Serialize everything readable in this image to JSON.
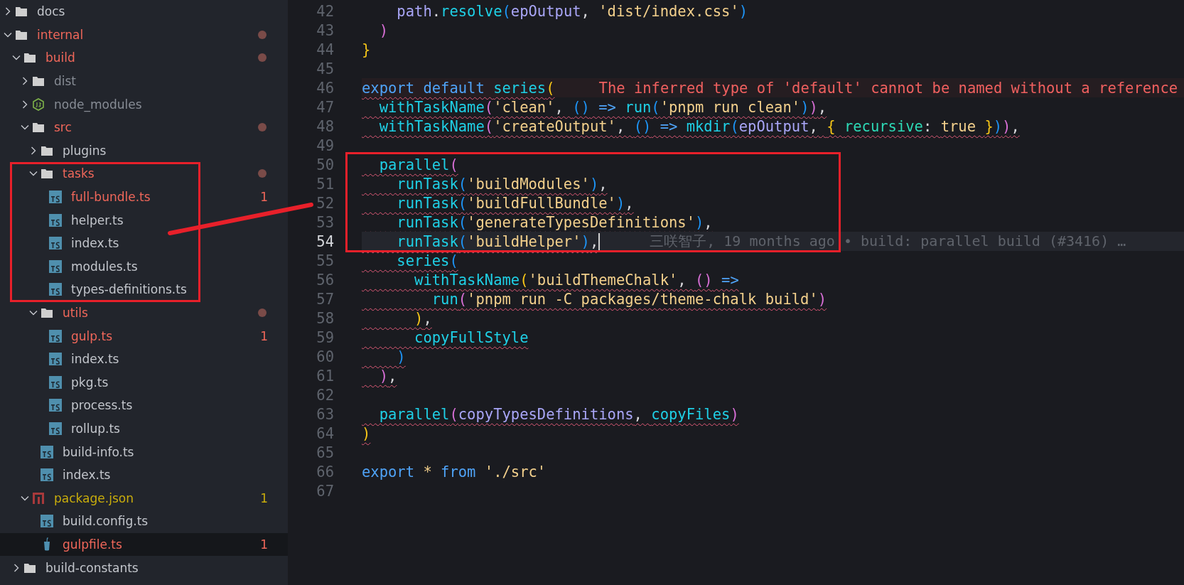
{
  "explorer": {
    "tree": [
      {
        "name": "docs",
        "kind": "folder",
        "expanded": false,
        "color": "#c3c6cc",
        "selected": false
      },
      {
        "name": "internal",
        "kind": "folder",
        "expanded": true,
        "color": "#f0675a",
        "dot": true,
        "selected": false,
        "children": [
          {
            "name": "build",
            "kind": "folder",
            "expanded": true,
            "color": "#f0675a",
            "dot": true,
            "selected": false,
            "children": [
              {
                "name": "dist",
                "kind": "folder",
                "expanded": false,
                "color": "#878c95",
                "selected": false
              },
              {
                "name": "node_modules",
                "kind": "node-folder",
                "expanded": false,
                "color": "#878c95",
                "selected": false
              },
              {
                "name": "src",
                "kind": "folder",
                "expanded": true,
                "color": "#f0675a",
                "dot": true,
                "selected": false,
                "children": [
                  {
                    "name": "plugins",
                    "kind": "folder",
                    "expanded": false,
                    "color": "#c3c6cc",
                    "selected": false
                  },
                  {
                    "name": "tasks",
                    "kind": "folder",
                    "expanded": true,
                    "color": "#f0675a",
                    "dot": true,
                    "boxed": true,
                    "selected": false,
                    "children": [
                      {
                        "name": "full-bundle.ts",
                        "kind": "ts",
                        "color": "#f0675a",
                        "badge": "1",
                        "selected": false
                      },
                      {
                        "name": "helper.ts",
                        "kind": "ts",
                        "color": "#c3c6cc",
                        "selected": false
                      },
                      {
                        "name": "index.ts",
                        "kind": "ts",
                        "color": "#c3c6cc",
                        "selected": false
                      },
                      {
                        "name": "modules.ts",
                        "kind": "ts",
                        "color": "#c3c6cc",
                        "selected": false
                      },
                      {
                        "name": "types-definitions.ts",
                        "kind": "ts",
                        "color": "#c3c6cc",
                        "selected": false
                      }
                    ]
                  },
                  {
                    "name": "utils",
                    "kind": "folder",
                    "expanded": true,
                    "color": "#f0675a",
                    "dot": true,
                    "selected": false,
                    "children": [
                      {
                        "name": "gulp.ts",
                        "kind": "ts",
                        "color": "#f0675a",
                        "badge": "1",
                        "selected": false
                      },
                      {
                        "name": "index.ts",
                        "kind": "ts",
                        "color": "#c3c6cc",
                        "selected": false
                      },
                      {
                        "name": "pkg.ts",
                        "kind": "ts",
                        "color": "#c3c6cc",
                        "selected": false
                      },
                      {
                        "name": "process.ts",
                        "kind": "ts",
                        "color": "#c3c6cc",
                        "selected": false
                      },
                      {
                        "name": "rollup.ts",
                        "kind": "ts",
                        "color": "#c3c6cc",
                        "selected": false
                      }
                    ]
                  },
                  {
                    "name": "build-info.ts",
                    "kind": "ts",
                    "color": "#c3c6cc",
                    "selected": false
                  },
                  {
                    "name": "index.ts",
                    "kind": "ts",
                    "color": "#c3c6cc",
                    "selected": false
                  }
                ]
              },
              {
                "name": "package.json",
                "kind": "json",
                "expanded": true,
                "color": "#c9ad0c",
                "badge": "1",
                "selected": false,
                "children": [
                  {
                    "name": "build.config.ts",
                    "kind": "ts",
                    "color": "#c3c6cc",
                    "selected": false
                  },
                  {
                    "name": "gulpfile.ts",
                    "kind": "gulp",
                    "color": "#f0675a",
                    "badge": "1",
                    "selected": true
                  }
                ]
              }
            ]
          },
          {
            "name": "build-constants",
            "kind": "folder",
            "expanded": false,
            "color": "#c3c6cc",
            "selected": false
          }
        ]
      }
    ]
  },
  "editor": {
    "lines": [
      {
        "number": "42",
        "tokens": [
          {
            "text": "    path",
            "kind": "param"
          },
          {
            "text": ".",
            "kind": "plain"
          },
          {
            "text": "resolve",
            "kind": "func"
          },
          {
            "text": "(",
            "kind": "b3"
          },
          {
            "text": "epOutput",
            "kind": "param"
          },
          {
            "text": ", ",
            "kind": "plain"
          },
          {
            "text": "'dist/index.css'",
            "kind": "string"
          },
          {
            "text": ")",
            "kind": "b3"
          }
        ]
      },
      {
        "number": "43",
        "tokens": [
          {
            "text": "  )",
            "kind": "b2"
          }
        ]
      },
      {
        "number": "44",
        "tokens": [
          {
            "text": "}",
            "kind": "b1"
          }
        ]
      },
      {
        "number": "45"
      },
      {
        "number": "46",
        "squiggle": true,
        "tokens": [
          {
            "text": "export default ",
            "kind": "keyword"
          },
          {
            "text": "series",
            "kind": "func"
          },
          {
            "text": "(",
            "kind": "b1"
          }
        ],
        "diagnostic": "The inferred type of 'default' cannot be named without a reference"
      },
      {
        "number": "47",
        "squiggle": true,
        "tokens": [
          {
            "text": "  withTaskName",
            "kind": "func"
          },
          {
            "text": "(",
            "kind": "b2"
          },
          {
            "text": "'clean'",
            "kind": "string"
          },
          {
            "text": ", ",
            "kind": "plain"
          },
          {
            "text": "()",
            "kind": "b3"
          },
          {
            "text": " => ",
            "kind": "keyword"
          },
          {
            "text": "run",
            "kind": "func"
          },
          {
            "text": "(",
            "kind": "b3"
          },
          {
            "text": "'pnpm run clean'",
            "kind": "string"
          },
          {
            "text": ")",
            "kind": "b3"
          },
          {
            "text": ")",
            "kind": "b2"
          },
          {
            "text": ",",
            "kind": "plain"
          }
        ]
      },
      {
        "number": "48",
        "squiggle": true,
        "tokens": [
          {
            "text": "  withTaskName",
            "kind": "func"
          },
          {
            "text": "(",
            "kind": "b2"
          },
          {
            "text": "'createOutput'",
            "kind": "string"
          },
          {
            "text": ", ",
            "kind": "plain"
          },
          {
            "text": "()",
            "kind": "b3"
          },
          {
            "text": " => ",
            "kind": "keyword"
          },
          {
            "text": "mkdir",
            "kind": "func"
          },
          {
            "text": "(",
            "kind": "b3"
          },
          {
            "text": "epOutput",
            "kind": "param"
          },
          {
            "text": ", ",
            "kind": "plain"
          },
          {
            "text": "{ ",
            "kind": "b1"
          },
          {
            "text": "recursive",
            "kind": "prop"
          },
          {
            "text": ": ",
            "kind": "plain"
          },
          {
            "text": "true ",
            "kind": "string"
          },
          {
            "text": "}",
            "kind": "b1"
          },
          {
            "text": ")",
            "kind": "b3"
          },
          {
            "text": ")",
            "kind": "b2"
          },
          {
            "text": ",",
            "kind": "plain"
          }
        ]
      },
      {
        "number": "49"
      },
      {
        "number": "50",
        "squiggle": true,
        "boxed": true,
        "tokens": [
          {
            "text": "  parallel",
            "kind": "func"
          },
          {
            "text": "(",
            "kind": "b2"
          }
        ]
      },
      {
        "number": "51",
        "squiggle": true,
        "boxed": true,
        "tokens": [
          {
            "text": "    runTask",
            "kind": "func"
          },
          {
            "text": "(",
            "kind": "b3"
          },
          {
            "text": "'buildModules'",
            "kind": "string"
          },
          {
            "text": ")",
            "kind": "b3"
          },
          {
            "text": ",",
            "kind": "plain"
          }
        ]
      },
      {
        "number": "52",
        "squiggle": true,
        "boxed": true,
        "tokens": [
          {
            "text": "    runTask",
            "kind": "func"
          },
          {
            "text": "(",
            "kind": "b3"
          },
          {
            "text": "'buildFullBundle'",
            "kind": "string"
          },
          {
            "text": ")",
            "kind": "b3"
          },
          {
            "text": ",",
            "kind": "plain"
          }
        ]
      },
      {
        "number": "53",
        "squiggle": true,
        "boxed": true,
        "tokens": [
          {
            "text": "    runTask",
            "kind": "func"
          },
          {
            "text": "(",
            "kind": "b3"
          },
          {
            "text": "'generateTypesDefinitions'",
            "kind": "string"
          },
          {
            "text": ")",
            "kind": "b3"
          },
          {
            "text": ",",
            "kind": "plain"
          }
        ]
      },
      {
        "number": "54",
        "squiggle": true,
        "boxed": true,
        "current": true,
        "tokens": [
          {
            "text": "    runTask",
            "kind": "func"
          },
          {
            "text": "(",
            "kind": "b3"
          },
          {
            "text": "'buildHelper'",
            "kind": "string"
          },
          {
            "text": ")",
            "kind": "b3"
          },
          {
            "text": ",",
            "kind": "plain"
          }
        ],
        "blame": "三咲智子, 19 months ago • build: parallel build (#3416) …"
      },
      {
        "number": "55",
        "squiggle": true,
        "tokens": [
          {
            "text": "    series",
            "kind": "func"
          },
          {
            "text": "(",
            "kind": "b3"
          }
        ]
      },
      {
        "number": "56",
        "squiggle": true,
        "tokens": [
          {
            "text": "      withTaskName",
            "kind": "func"
          },
          {
            "text": "(",
            "kind": "b1"
          },
          {
            "text": "'buildThemeChalk'",
            "kind": "string"
          },
          {
            "text": ", ",
            "kind": "plain"
          },
          {
            "text": "()",
            "kind": "b2"
          },
          {
            "text": " =>",
            "kind": "keyword"
          }
        ]
      },
      {
        "number": "57",
        "squiggle": true,
        "tokens": [
          {
            "text": "        run",
            "kind": "func"
          },
          {
            "text": "(",
            "kind": "b2"
          },
          {
            "text": "'pnpm run -C packages/theme-chalk build'",
            "kind": "string"
          },
          {
            "text": ")",
            "kind": "b2"
          }
        ]
      },
      {
        "number": "58",
        "squiggle": true,
        "tokens": [
          {
            "text": "      )",
            "kind": "b1"
          },
          {
            "text": ",",
            "kind": "plain"
          }
        ]
      },
      {
        "number": "59",
        "squiggle": true,
        "tokens": [
          {
            "text": "      copyFullStyle",
            "kind": "func"
          }
        ]
      },
      {
        "number": "60",
        "squiggle": true,
        "tokens": [
          {
            "text": "    )",
            "kind": "b3"
          }
        ]
      },
      {
        "number": "61",
        "squiggle": true,
        "tokens": [
          {
            "text": "  )",
            "kind": "b2"
          },
          {
            "text": ",",
            "kind": "plain"
          }
        ]
      },
      {
        "number": "62"
      },
      {
        "number": "63",
        "squiggle": true,
        "tokens": [
          {
            "text": "  parallel",
            "kind": "func"
          },
          {
            "text": "(",
            "kind": "b2"
          },
          {
            "text": "copyTypesDefinitions",
            "kind": "param"
          },
          {
            "text": ", ",
            "kind": "plain"
          },
          {
            "text": "copyFiles",
            "kind": "func"
          },
          {
            "text": ")",
            "kind": "b2"
          }
        ]
      },
      {
        "number": "64",
        "squiggle": true,
        "tokens": [
          {
            "text": ")",
            "kind": "b1"
          }
        ]
      },
      {
        "number": "65"
      },
      {
        "number": "66",
        "tokens": [
          {
            "text": "export",
            "kind": "keyword"
          },
          {
            "text": " * ",
            "kind": "string"
          },
          {
            "text": "from",
            "kind": "keyword"
          },
          {
            "text": " './src'",
            "kind": "string"
          }
        ]
      },
      {
        "number": "67"
      }
    ]
  },
  "annotations": [
    {
      "kind": "connector"
    }
  ]
}
